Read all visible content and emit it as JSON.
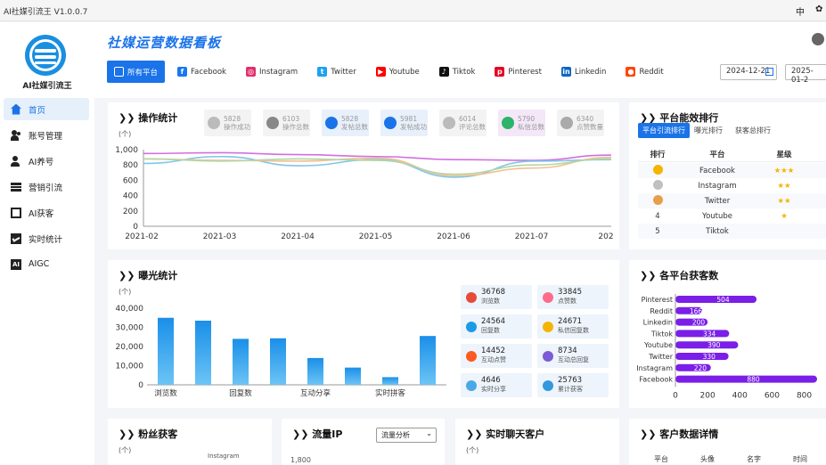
{
  "window": {
    "title": "AI社媒引流王 V1.0.0.7",
    "right_icons": [
      "中",
      "✿"
    ]
  },
  "sidebar": {
    "brand": "AI社媒引流王",
    "items": [
      {
        "label": "首页",
        "icon": "home-icon",
        "active": true
      },
      {
        "label": "账号管理",
        "icon": "users-icon",
        "active": false
      },
      {
        "label": "AI养号",
        "icon": "robot-user-icon",
        "active": false
      },
      {
        "label": "营销引流",
        "icon": "marketing-icon",
        "active": false
      },
      {
        "label": "AI获客",
        "icon": "target-icon",
        "active": false
      },
      {
        "label": "实时统计",
        "icon": "stats-icon",
        "active": false
      },
      {
        "label": "AIGC",
        "icon": "aigc-icon",
        "active": false
      }
    ]
  },
  "header": {
    "title": "社媒运营数据看板",
    "tabs": [
      {
        "label": "所有平台",
        "icon": "grid-icon",
        "color": "#1a73e8",
        "active": true
      },
      {
        "label": "Facebook",
        "icon": "facebook-icon",
        "color": "#1877f2"
      },
      {
        "label": "Instagram",
        "icon": "instagram-icon",
        "color": "#e1306c"
      },
      {
        "label": "Twitter",
        "icon": "twitter-icon",
        "color": "#1da1f2"
      },
      {
        "label": "Youtube",
        "icon": "youtube-icon",
        "color": "#ff0000"
      },
      {
        "label": "Tiktok",
        "icon": "tiktok-icon",
        "color": "#111111"
      },
      {
        "label": "Pinterest",
        "icon": "pinterest-icon",
        "color": "#e60023"
      },
      {
        "label": "Linkedin",
        "icon": "linkedin-icon",
        "color": "#0a66c2"
      },
      {
        "label": "Reddit",
        "icon": "reddit-icon",
        "color": "#ff4500"
      }
    ],
    "date_start": "2024-12-21",
    "date_end": "2025-01-2"
  },
  "ops": {
    "title": "操作统计",
    "unit": "(个)",
    "stats": [
      {
        "value": "5828",
        "label": "操作成功",
        "color": "#bbbbbb",
        "bg": "#f3f3f3"
      },
      {
        "value": "6103",
        "label": "操作总数",
        "color": "#888888",
        "bg": "#f3f3f3"
      },
      {
        "value": "5828",
        "label": "发帖总数",
        "color": "#1a73e8",
        "bg": "#e8f0fb"
      },
      {
        "value": "5981",
        "label": "发帖成功",
        "color": "#1a73e8",
        "bg": "#e8f0fb"
      },
      {
        "value": "6014",
        "label": "评论总数",
        "color": "#bbbbbb",
        "bg": "#f3f3f3"
      },
      {
        "value": "5790",
        "label": "私信总数",
        "color": "#2db36a",
        "bg": "#f3e7f8"
      },
      {
        "value": "6340",
        "label": "点赞数量",
        "color": "#aaaaaa",
        "bg": "#f3f3f3"
      }
    ]
  },
  "chart_data": [
    {
      "type": "line",
      "title": "操作统计",
      "ylabel": "(个)",
      "ylim": [
        0,
        1000
      ],
      "yticks": [
        "0",
        "200",
        "400",
        "600",
        "800",
        "1,000"
      ],
      "x": [
        "2021-02",
        "2021-03",
        "2021-04",
        "2021-05",
        "2021-06",
        "2021-07",
        "202"
      ],
      "series": [
        {
          "color": "#d070e0",
          "values": [
            950,
            960,
            935,
            910,
            870,
            860,
            930
          ]
        },
        {
          "color": "#7ec6e8",
          "values": [
            820,
            910,
            790,
            870,
            640,
            850,
            870
          ]
        },
        {
          "color": "#f0c090",
          "values": [
            880,
            860,
            850,
            890,
            660,
            760,
            900
          ]
        },
        {
          "color": "#b5d5a5",
          "values": [
            880,
            850,
            880,
            860,
            680,
            800,
            880
          ]
        }
      ]
    },
    {
      "type": "bar",
      "title": "曝光统计",
      "ylabel": "(个)",
      "ylim": [
        0,
        40000
      ],
      "yticks": [
        "0",
        "10,000",
        "20,000",
        "30,000",
        "40,000"
      ],
      "tick_labels": [
        "浏览数",
        "回复数",
        "互动分享",
        "实时拼客"
      ],
      "values": [
        35000,
        33500,
        24000,
        24300,
        14000,
        9000,
        4000,
        25500
      ]
    },
    {
      "type": "bar",
      "orientation": "horizontal",
      "title": "各平台获客数",
      "categories": [
        "Pinterest",
        "Reddit",
        "Linkedin",
        "Tiktok",
        "Youtube",
        "Twitter",
        "Instagram",
        "Facebook"
      ],
      "values": [
        504,
        166,
        200,
        334,
        390,
        330,
        220,
        880
      ],
      "xticks": [
        "0",
        "200",
        "400",
        "600",
        "800"
      ],
      "xlim": [
        0,
        880
      ]
    }
  ],
  "ranking": {
    "title": "平台能效排行",
    "tabs": [
      "平台引流排行",
      "曝光排行",
      "获客总排行"
    ],
    "headers": [
      "排行",
      "平台",
      "星级"
    ],
    "rows": [
      {
        "rank": "1",
        "platform": "Facebook",
        "stars": "★★★"
      },
      {
        "rank": "2",
        "platform": "Instagram",
        "stars": "★★"
      },
      {
        "rank": "3",
        "platform": "Twitter",
        "stars": "★★"
      },
      {
        "rank": "4",
        "platform": "Youtube",
        "stars": "★"
      },
      {
        "rank": "5",
        "platform": "Tiktok",
        "stars": ""
      }
    ]
  },
  "exposure": {
    "title": "曝光统计",
    "unit": "(个)",
    "stats": [
      {
        "value": "36768",
        "label": "浏览数",
        "color": "#e64a3b"
      },
      {
        "value": "33845",
        "label": "点赞数",
        "color": "#ff6b8a"
      },
      {
        "value": "24564",
        "label": "回复数",
        "color": "#1a9be6"
      },
      {
        "value": "24671",
        "label": "私信回复数",
        "color": "#f5b400"
      },
      {
        "value": "14452",
        "label": "互动点赞",
        "color": "#ff5a1f"
      },
      {
        "value": "8734",
        "label": "互动总回复",
        "color": "#7b5cd6"
      },
      {
        "value": "4646",
        "label": "实时分享",
        "color": "#4aa8e8"
      },
      {
        "value": "25763",
        "label": "累计获客",
        "color": "#3399dd"
      }
    ]
  },
  "acq": {
    "title": "各平台获客数"
  },
  "bottom": {
    "fans": {
      "title": "粉丝获客",
      "unit": "(个)",
      "legend": "Instagram"
    },
    "flow": {
      "title": "流量IP",
      "select": "流量分析",
      "tick": "1,800"
    },
    "chat": {
      "title": "实时聊天客户",
      "unit": "(个)"
    },
    "details": {
      "title": "客户数据详情",
      "headers": [
        "平台",
        "头像",
        "名字",
        "时间"
      ]
    }
  }
}
